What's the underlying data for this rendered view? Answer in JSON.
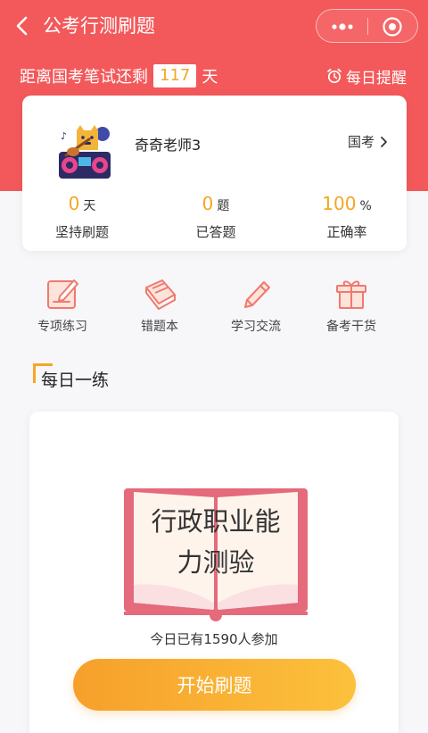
{
  "nav": {
    "title": "公考行测刷题",
    "back_icon": "chevron-left-icon",
    "more_icon": "more-dots-icon",
    "close_icon": "target-circle-icon"
  },
  "countdown": {
    "prefix": "距离国考笔试还剩",
    "days": "117",
    "suffix": "天"
  },
  "reminder": {
    "label": "每日提醒",
    "icon": "alarm-clock-icon"
  },
  "profile": {
    "username": "奇奇老师3",
    "exam_type": "国考",
    "stats": [
      {
        "value": "0",
        "unit": "天",
        "label": "坚持刷题"
      },
      {
        "value": "0",
        "unit": "题",
        "label": "已答题"
      },
      {
        "value": "100",
        "unit": "%",
        "label": "正确率"
      }
    ]
  },
  "menu": [
    {
      "label": "专项练习",
      "icon": "edit-note-icon"
    },
    {
      "label": "错题本",
      "icon": "notebook-icon"
    },
    {
      "label": "学习交流",
      "icon": "pencil-icon"
    },
    {
      "label": "备考干货",
      "icon": "gift-icon"
    }
  ],
  "daily": {
    "section_title": "每日一练",
    "book_line1": "行政职业能",
    "book_line2": "力测验",
    "participants": "今日已有1590人参加",
    "start_label": "开始刷题"
  },
  "colors": {
    "primary": "#f3595b",
    "accent": "#f5a623",
    "button_start": "#f6a02b",
    "button_end": "#fcc13c",
    "icon_line": "#f0796f"
  }
}
